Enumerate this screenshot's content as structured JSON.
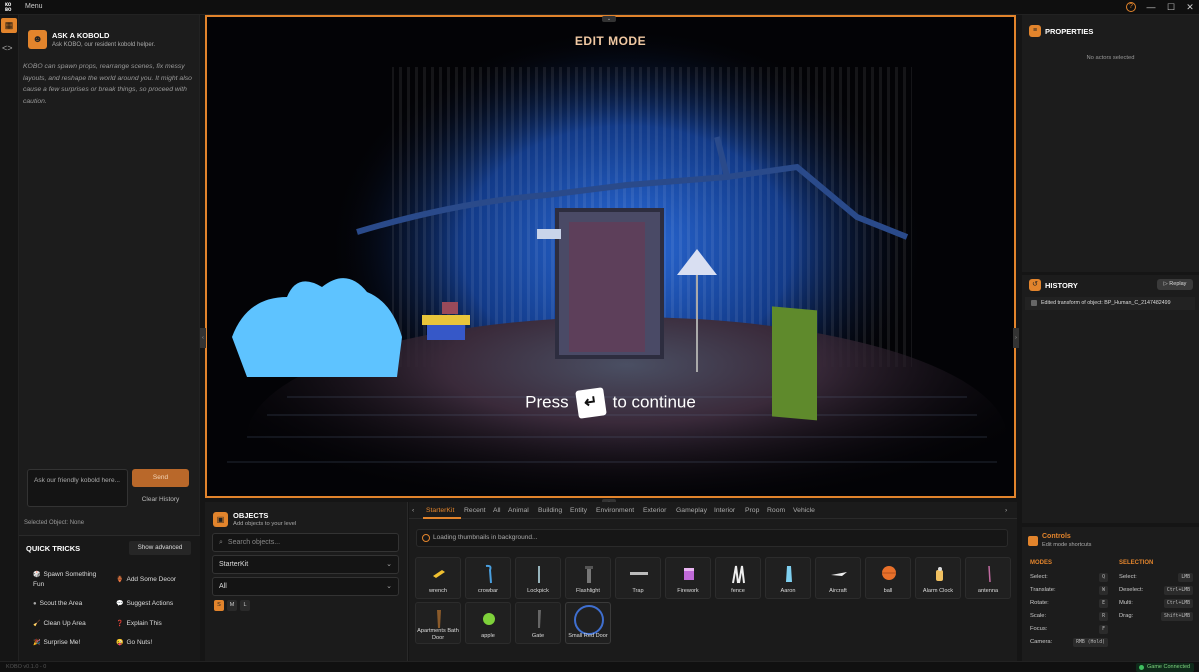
{
  "titlebar": {
    "menu": "Menu",
    "logo_top": "KO",
    "logo_bottom": "BO",
    "minimize": "—",
    "maximize": "☐",
    "close": "✕",
    "help": "?"
  },
  "left": {
    "ask_title": "ASK A KOBOLD",
    "ask_subtitle": "Ask KOBO, our resident kobold helper.",
    "description": "KOBO can spawn props, rearrange scenes, fix messy layouts, and reshape the world around you. It might also cause a few surprises or break things, so proceed with caution.",
    "input_placeholder": "Ask our friendly kobold here...",
    "send": "Send",
    "clear_history": "Clear History",
    "selected_object": "Selected Object: None",
    "quick_tricks_title": "QUICK TRICKS",
    "show_advanced": "Show advanced",
    "tricks": [
      {
        "label": "Spawn Something Fun",
        "icon": "🎲"
      },
      {
        "label": "Add Some Decor",
        "icon": "🏺"
      },
      {
        "label": "Scout the Area",
        "icon": "●"
      },
      {
        "label": "Suggest Actions",
        "icon": "💬"
      },
      {
        "label": "Clean Up Area",
        "icon": "🧹"
      },
      {
        "label": "Explain This",
        "icon": "❓"
      },
      {
        "label": "Surprise Me!",
        "icon": "🎉"
      },
      {
        "label": "Go Nuts!",
        "icon": "😜"
      }
    ]
  },
  "viewport": {
    "mode": "EDIT MODE",
    "press": "Press",
    "continue": "to continue",
    "key_glyph": "↵"
  },
  "objects": {
    "title": "OBJECTS",
    "subtitle": "Add objects to your level",
    "search_placeholder": "Search objects...",
    "kit": "StarterKit",
    "filter": "All",
    "sizes": [
      "S",
      "M",
      "L"
    ]
  },
  "browser": {
    "tabs": [
      "StarterKit",
      "Recent",
      "All",
      "Animal",
      "Building",
      "Entity",
      "Environment",
      "Exterior",
      "Gameplay",
      "Interior",
      "Prop",
      "Room",
      "Vehicle"
    ],
    "loading": "Loading thumbnails in background...",
    "assets": [
      "wrench",
      "crowbar",
      "Lockpick",
      "Flashlight",
      "Trap",
      "Firework",
      "fence",
      "Aaron",
      "Aircraft",
      "ball",
      "Alarm Clock",
      "antenna",
      "Apartments Bath Door",
      "apple",
      "Gate",
      "Small Red Door"
    ]
  },
  "properties": {
    "title": "PROPERTIES",
    "empty": "No actors selected"
  },
  "history": {
    "title": "HISTORY",
    "replay": "▷ Replay",
    "entries": [
      "Edited transform of object: BP_Human_C_2147482499"
    ]
  },
  "controls": {
    "title": "Controls",
    "subtitle": "Edit mode shortcuts",
    "modes_head": "MODES",
    "selection_head": "SELECTION",
    "modes": [
      {
        "label": "Select:",
        "key": "Q"
      },
      {
        "label": "Translate:",
        "key": "W"
      },
      {
        "label": "Rotate:",
        "key": "E"
      },
      {
        "label": "Scale:",
        "key": "R"
      },
      {
        "label": "Focus:",
        "key": "F"
      },
      {
        "label": "Camera:",
        "key": "RMB (Hold)"
      }
    ],
    "selection": [
      {
        "label": "Select:",
        "key": "LMB"
      },
      {
        "label": "Deselect:",
        "key": "Ctrl+LMB"
      },
      {
        "label": "Multi:",
        "key": "Ctrl+LMB"
      },
      {
        "label": "Drag:",
        "key": "Shift+LMB"
      }
    ]
  },
  "status": {
    "version": "KOBO v0.1.0 - 0",
    "connection": "Game Connected"
  },
  "colors": {
    "accent": "#e2842c",
    "panel": "#1c1c1c",
    "background": "#151515"
  }
}
